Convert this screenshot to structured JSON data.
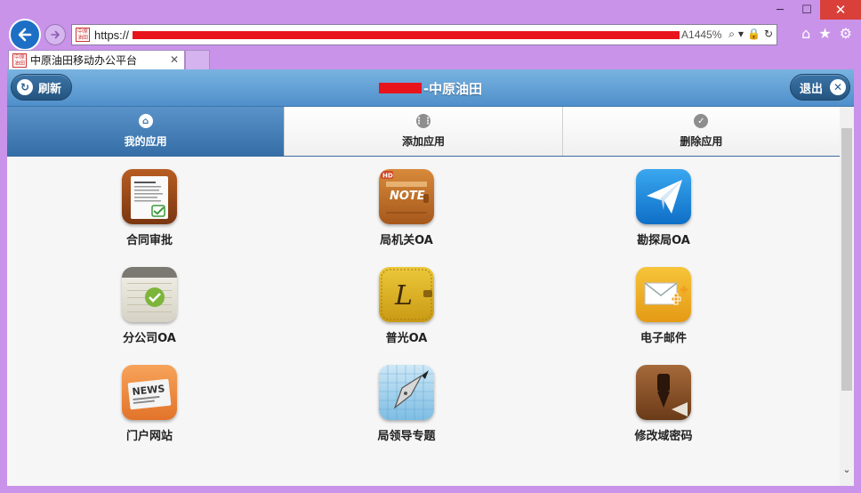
{
  "window": {
    "minimize_label": "─",
    "maximize_label": "☐",
    "close_label": "✕"
  },
  "browser": {
    "url_prefix": "https://",
    "url_suffix": "A1445%",
    "tab_title": "中原油田移动办公平台",
    "tab_close": "✕",
    "favicon_text": "中原油田"
  },
  "header": {
    "refresh_label": "刷新",
    "title_suffix": "-中原油田",
    "logout_label": "退出"
  },
  "segments": [
    {
      "label": "我的应用",
      "active": true
    },
    {
      "label": "添加应用",
      "active": false
    },
    {
      "label": "删除应用",
      "active": false
    }
  ],
  "apps": [
    {
      "label": "合同审批",
      "icon": "contract-icon"
    },
    {
      "label": "局机关OA",
      "icon": "note-icon"
    },
    {
      "label": "勘探局OA",
      "icon": "paper-plane-icon"
    },
    {
      "label": "分公司OA",
      "icon": "notepad-check-icon"
    },
    {
      "label": "普光OA",
      "icon": "leather-notebook-icon"
    },
    {
      "label": "电子邮件",
      "icon": "mail-icon"
    },
    {
      "label": "门户网站",
      "icon": "news-icon"
    },
    {
      "label": "局领导专题",
      "icon": "pen-nib-icon"
    },
    {
      "label": "修改域密码",
      "icon": "password-pen-icon"
    }
  ],
  "colors": {
    "header_top": "#79b3e0",
    "header_bottom": "#4f8fcb",
    "active_segment": "#4a85bd",
    "window_frame": "#c993ea",
    "redaction": "#e8141c"
  }
}
